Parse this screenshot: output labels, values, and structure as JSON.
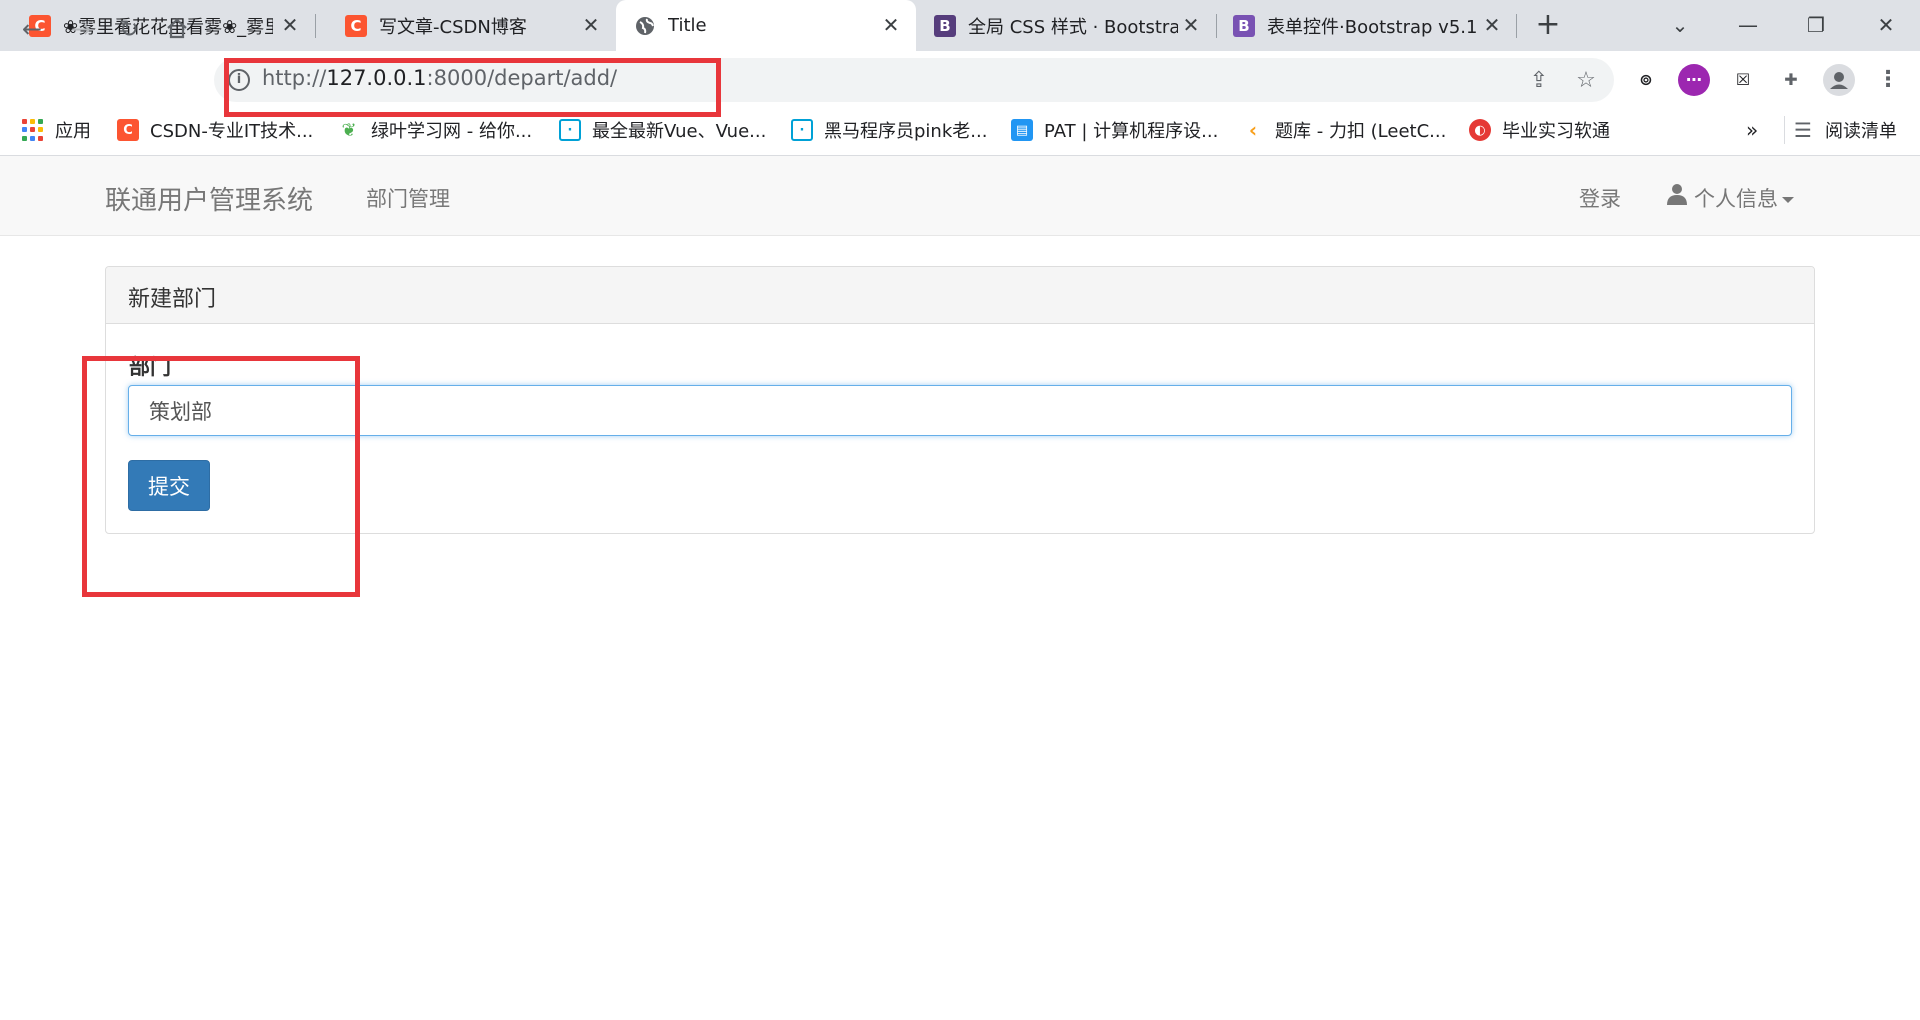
{
  "browser": {
    "tabs": [
      {
        "title": "❀雾里看花花里看雾❀_雾里看花",
        "icon": "C",
        "color": "#fc5531"
      },
      {
        "title": "写文章-CSDN博客",
        "icon": "C",
        "color": "#fc5531"
      },
      {
        "title": "Title",
        "icon": "globe",
        "color": "#5f6368"
      },
      {
        "title": "全局 CSS 样式 · Bootstrap",
        "icon": "B",
        "color": "#563d7c"
      },
      {
        "title": "表单控件·Bootstrap v5.1",
        "icon": "B",
        "color": "#7952b3"
      }
    ],
    "tab_close": "✕",
    "new_tab": "+",
    "url_scheme": "http://",
    "url_host": "127.0.0.1",
    "url_path": ":8000/depart/add/",
    "bookmarks": [
      {
        "label": "应用",
        "icon": "apps-grid"
      },
      {
        "label": "CSDN-专业IT技术...",
        "icon": "C",
        "color": "#fc5531"
      },
      {
        "label": "绿叶学习网 - 给你...",
        "icon": "leaf",
        "color": "#4caf50"
      },
      {
        "label": "最全最新Vue、Vue...",
        "icon": "bilibili",
        "color": "#00a1d6"
      },
      {
        "label": "黑马程序员pink老...",
        "icon": "bilibili",
        "color": "#00a1d6"
      },
      {
        "label": "PAT | 计算机程序设...",
        "icon": "pat",
        "color": "#2196f3"
      },
      {
        "label": "题库 - 力扣 (LeetC...",
        "icon": "leetcode",
        "color": "#f89f1b"
      },
      {
        "label": "毕业实习软通",
        "icon": "softstone",
        "color": "#e53935"
      }
    ],
    "bookmarks_more": "»",
    "reading_list": "阅读清单"
  },
  "navbar": {
    "brand": "联通用户管理系统",
    "link_depart": "部门管理",
    "link_login": "登录",
    "link_profile": "个人信息"
  },
  "panel": {
    "title": "新建部门",
    "field_label": "部门",
    "field_value": "策划部",
    "submit_label": "提交"
  },
  "colors": {
    "annotation": "#e8363b",
    "primary": "#337ab7"
  }
}
